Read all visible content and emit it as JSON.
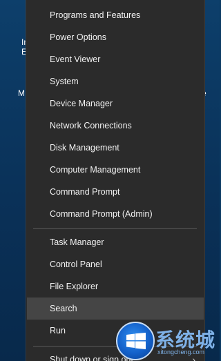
{
  "desktop": {
    "text_a": "In",
    "text_b": "E",
    "text_c": "M",
    "text_d": "e"
  },
  "menu": {
    "items": [
      {
        "label": "Programs and Features"
      },
      {
        "label": "Power Options"
      },
      {
        "label": "Event Viewer"
      },
      {
        "label": "System"
      },
      {
        "label": "Device Manager"
      },
      {
        "label": "Network Connections"
      },
      {
        "label": "Disk Management"
      },
      {
        "label": "Computer Management"
      },
      {
        "label": "Command Prompt"
      },
      {
        "label": "Command Prompt (Admin)"
      },
      {
        "label": "Task Manager"
      },
      {
        "label": "Control Panel"
      },
      {
        "label": "File Explorer"
      },
      {
        "label": "Search"
      },
      {
        "label": "Run"
      },
      {
        "label": "Shut down or sign out"
      }
    ],
    "submenu_chevron": "›"
  },
  "watermark": {
    "icon": "windows-logo-icon",
    "text": "系统城",
    "subtext": "xitongcheng.com"
  }
}
